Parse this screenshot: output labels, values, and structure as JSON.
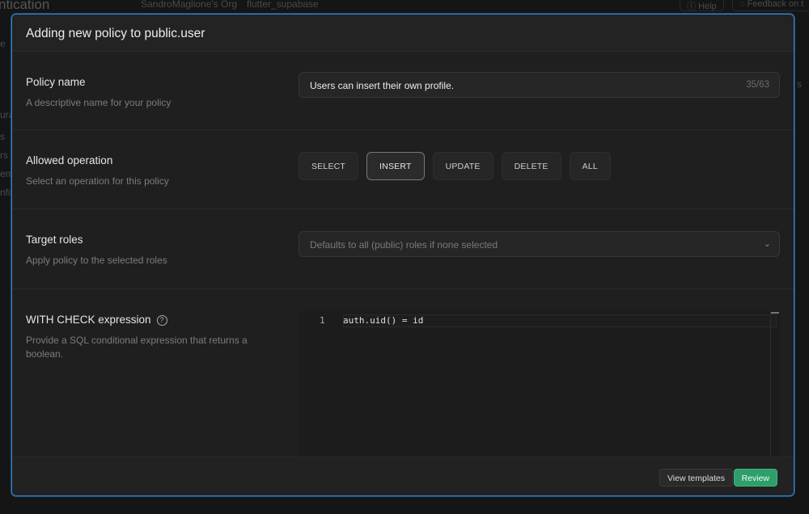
{
  "background": {
    "title": "ntication",
    "org": "SandroMaglione's Org",
    "project": "flutter_supabase",
    "help": "Help",
    "feedback": "Feedback on t",
    "sidebar_fragments": [
      "e",
      "ura",
      "s",
      "rs",
      "em",
      "nfi"
    ],
    "right_fragment": "s"
  },
  "modal": {
    "title": "Adding new policy to public.user",
    "policy_name": {
      "label": "Policy name",
      "description": "A descriptive name for your policy",
      "value": "Users can insert their own profile.",
      "count": "35/63"
    },
    "operation": {
      "label": "Allowed operation",
      "description": "Select an operation for this policy",
      "options": [
        "SELECT",
        "INSERT",
        "UPDATE",
        "DELETE",
        "ALL"
      ],
      "selected": "INSERT"
    },
    "roles": {
      "label": "Target roles",
      "description": "Apply policy to the selected roles",
      "placeholder": "Defaults to all (public) roles if none selected"
    },
    "check": {
      "label": "WITH CHECK expression",
      "description": "Provide a SQL conditional expression that returns a boolean.",
      "line_number": "1",
      "code": "auth.uid() = id"
    },
    "footer": {
      "view_templates": "View templates",
      "review": "Review"
    }
  },
  "colors": {
    "accent_border": "#3b82c4",
    "review": "#2e9e6b"
  }
}
